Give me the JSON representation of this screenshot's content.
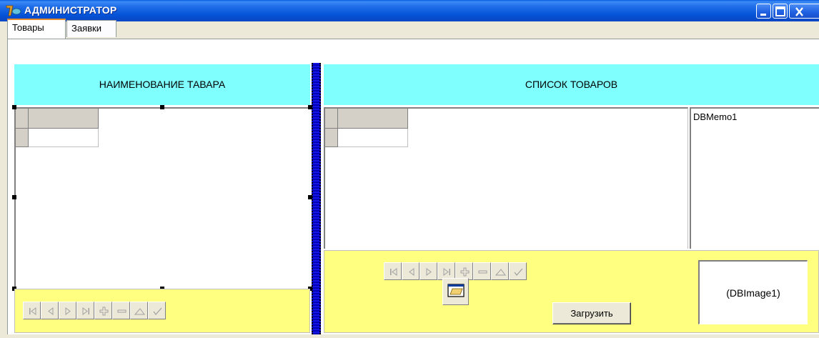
{
  "window": {
    "title": "АДМИНИСТРАТОР",
    "title_color": "#0a5ce0"
  },
  "tabs": [
    {
      "label": "Товары",
      "active": true
    },
    {
      "label": "Заявки",
      "active": false
    }
  ],
  "left": {
    "header": "НАИМЕНОВАНИЕ ТАВАРА",
    "header_color": "#80ffff",
    "navigator_color": "#ffff80"
  },
  "right": {
    "header": "СПИСОК ТОВАРОВ",
    "memo_text": "DBMemo1",
    "image_text": "(DBImage1)",
    "load_button": "Загрузить"
  },
  "navigator_icons": [
    "first-icon",
    "prior-icon",
    "next-icon",
    "last-icon",
    "insert-icon",
    "delete-icon",
    "edit-icon",
    "post-icon"
  ]
}
